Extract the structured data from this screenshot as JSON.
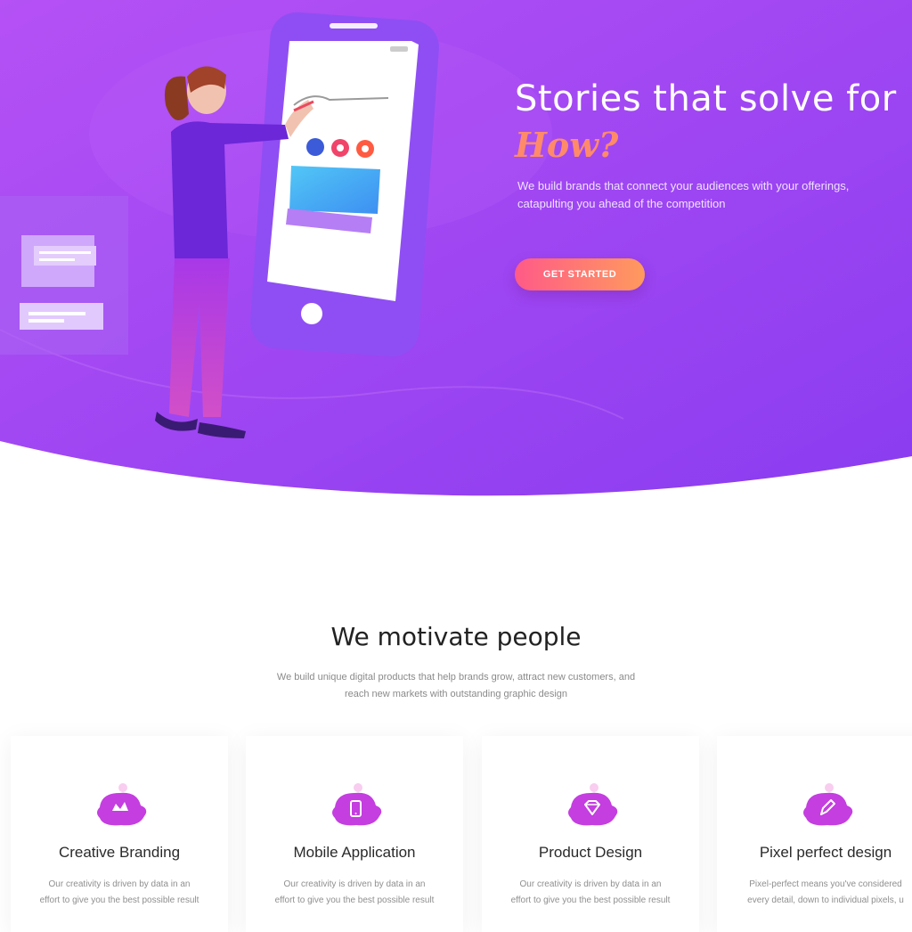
{
  "hero": {
    "title": "Stories that solve for",
    "highlight": "How?",
    "description_lines": [
      "We build brands that connect your audiences with your offerings,",
      "catapulting you ahead of the competition"
    ],
    "cta_label": "GET STARTED"
  },
  "section": {
    "title": "We motivate people",
    "subtitle_lines": [
      "We build unique digital products that help brands grow, attract new customers, and",
      "reach new markets with outstanding graphic design"
    ]
  },
  "services": [
    {
      "title": "Creative Branding",
      "icon": "crown-icon",
      "text_lines": [
        "Our creativity is driven by data in an",
        "effort to give you the best possible result"
      ]
    },
    {
      "title": "Mobile Application",
      "icon": "smartphone-icon",
      "text_lines": [
        "Our creativity is driven by data in an",
        "effort to give you the best possible result"
      ]
    },
    {
      "title": "Product Design",
      "icon": "diamond-icon",
      "text_lines": [
        "Our creativity is driven by data in an",
        "effort to give you the best possible result"
      ]
    },
    {
      "title": "Pixel perfect design",
      "icon": "pen-icon",
      "text_lines": [
        "Pixel-perfect means you've considered",
        "every detail, down to individual pixels, u"
      ]
    }
  ],
  "colors": {
    "hero_gradient_start": "#b14cf4",
    "hero_gradient_end": "#8d3df2",
    "accent_orange": "#ff8a6a",
    "cta_gradient_start": "#ff5a87",
    "cta_gradient_end": "#ff9a5e",
    "icon_magenta": "#c43ee0"
  }
}
